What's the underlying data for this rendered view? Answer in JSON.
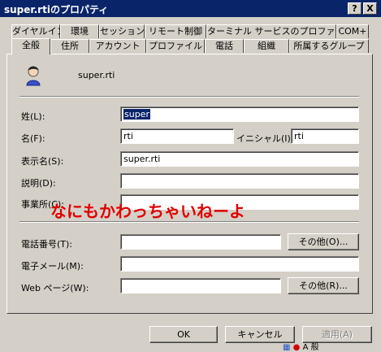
{
  "window": {
    "title": "super.rtiのプロパティ",
    "help_btn": "?",
    "close_btn": "X"
  },
  "tabs_row1": [
    "ダイヤルイン",
    "環境",
    "セッション",
    "リモート制御",
    "ターミナル サービスのプロファイル",
    "COM+"
  ],
  "tabs_row2": [
    "全般",
    "住所",
    "アカウント",
    "プロファイル",
    "電話",
    "組織",
    "所属するグループ"
  ],
  "active_tab": "全般",
  "user": {
    "display": "super.rti"
  },
  "fields": {
    "last_name": {
      "label": "姓(L):",
      "value": "super"
    },
    "first_name": {
      "label": "名(F):",
      "value": "rti"
    },
    "initials": {
      "label": "イニシャル(I):",
      "value": "rti"
    },
    "display_name": {
      "label": "表示名(S):",
      "value": "super.rti"
    },
    "description": {
      "label": "説明(D):",
      "value": ""
    },
    "office": {
      "label": "事業所(C):",
      "value": ""
    },
    "phone": {
      "label": "電話番号(T):",
      "value": "",
      "other_btn": "その他(O)..."
    },
    "email": {
      "label": "電子メール(M):",
      "value": ""
    },
    "webpage": {
      "label": "Web ページ(W):",
      "value": "",
      "other_btn": "その他(R)..."
    }
  },
  "overlay_text": "なにもかわっちゃいねーよ",
  "buttons": {
    "ok": "OK",
    "cancel": "キャンセル",
    "apply": "適用(A)"
  },
  "tray": {
    "text": "A 般"
  }
}
